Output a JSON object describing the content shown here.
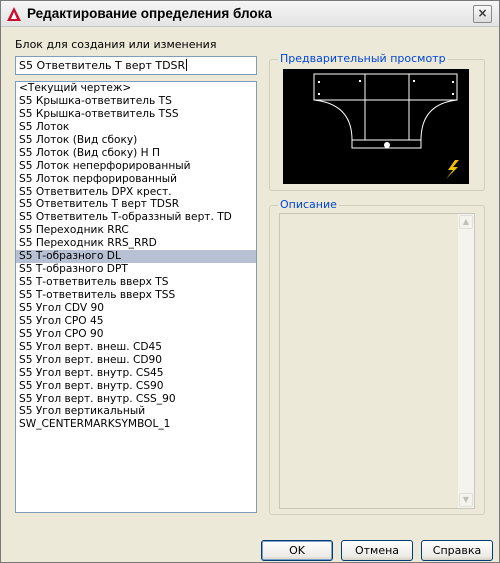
{
  "window": {
    "title": "Редактирование определения блока",
    "close_glyph": "×"
  },
  "block_label": "Блок для создания или изменения",
  "block_name_value": "S5 Ответвитель Т верт TDSR",
  "block_list": {
    "selected_index": 13,
    "items": [
      "<Текущий чертеж>",
      "S5 Крышка-ответвитель TS",
      "S5 Крышка-ответвитель TSS",
      "S5 Лоток",
      "S5 Лоток (Вид сбоку)",
      "S5 Лоток (Вид сбоку) Н П",
      "S5 Лоток неперфорированный",
      "S5 Лоток перфорированный",
      "S5 Ответвитель DPX крест.",
      "S5 Ответвитель Т верт TDSR",
      "S5 Ответвитель Т-образзный верт. TD",
      "S5 Переходник RRC",
      "S5 Переходник RRS_RRD",
      "S5 Т-образного DL",
      "S5 Т-образного DPT",
      "S5 Т-ответвитель вверх TS",
      "S5 Т-ответвитель вверх TSS",
      "S5 Угол CDV 90",
      "S5 Угол CPO 45",
      "S5 Угол CPO 90",
      "S5 Угол верт. внеш. CD45",
      "S5 Угол верт. внеш. CD90",
      "S5 Угол верт. внутр. CS45",
      "S5 Угол верт. внутр. CS90",
      "S5 Угол верт. внутр. CSS_90",
      "S5 Угол вертикальный",
      "SW_CENTERMARKSYMBOL_1"
    ]
  },
  "preview": {
    "legend": "Предварительный просмотр",
    "lightning_icon": "lightning-icon"
  },
  "description": {
    "legend": "Описание",
    "text": ""
  },
  "buttons": {
    "ok": "OK",
    "cancel": "Отмена",
    "help": "Справка"
  },
  "colors": {
    "accent_legend": "#0046d5",
    "selection": "#b8c0d4",
    "preview_bg": "#000000",
    "lightning": "#f0c000"
  }
}
